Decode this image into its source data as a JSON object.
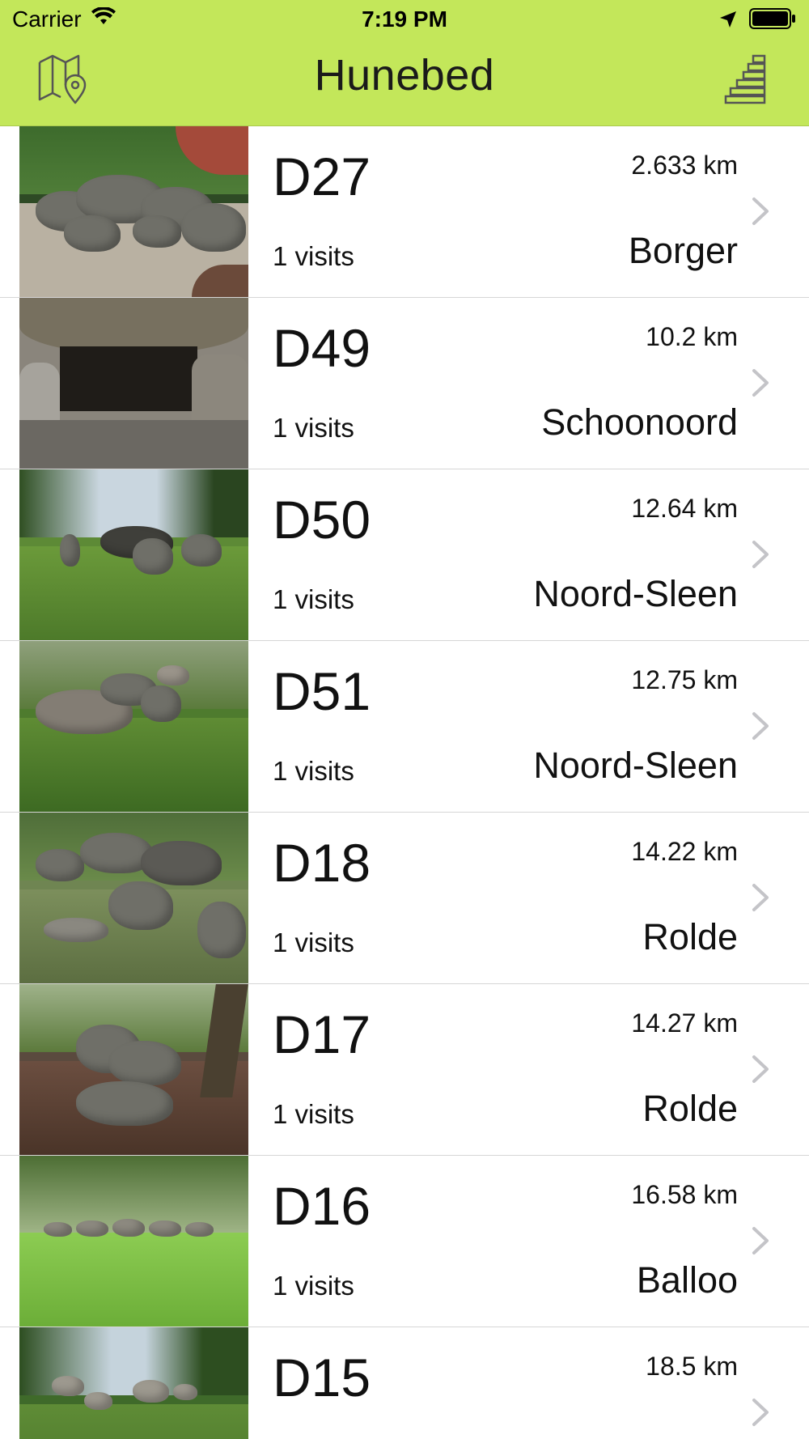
{
  "status_bar": {
    "carrier": "Carrier",
    "time": "7:19 PM",
    "icons": [
      "wifi-icon",
      "location-arrow-icon",
      "battery-icon"
    ]
  },
  "nav": {
    "title": "Hunebed",
    "left_icon": "map-icon",
    "right_icon": "stairs-icon"
  },
  "colors": {
    "nav_bg": "#c3e75a",
    "accent": "#e8620f"
  },
  "rows": [
    {
      "name": "D27",
      "distance": "2.633 km",
      "visits": "1 visits",
      "place": "Borger"
    },
    {
      "name": "D49",
      "distance": "10.2 km",
      "visits": "1 visits",
      "place": "Schoonoord"
    },
    {
      "name": "D50",
      "distance": "12.64 km",
      "visits": "1 visits",
      "place": "Noord-Sleen"
    },
    {
      "name": "D51",
      "distance": "12.75 km",
      "visits": "1 visits",
      "place": "Noord-Sleen"
    },
    {
      "name": "D18",
      "distance": "14.22 km",
      "visits": "1 visits",
      "place": "Rolde"
    },
    {
      "name": "D17",
      "distance": "14.27 km",
      "visits": "1 visits",
      "place": "Rolde"
    },
    {
      "name": "D16",
      "distance": "16.58 km",
      "visits": "1 visits",
      "place": "Balloo"
    },
    {
      "name": "D15",
      "distance": "18.5 km",
      "visits": "",
      "place": ""
    }
  ]
}
